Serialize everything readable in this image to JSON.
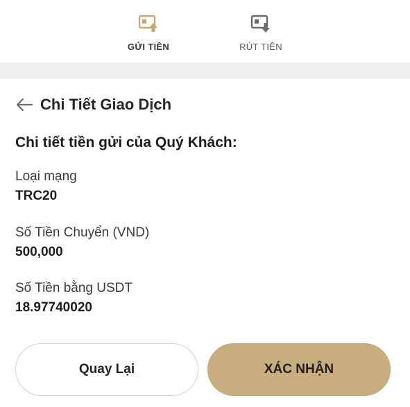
{
  "tabs": {
    "deposit": {
      "label": "GỬI TIỀN",
      "icon": "deposit-icon"
    },
    "withdraw": {
      "label": "RÚT TIỀN",
      "icon": "withdraw-icon"
    }
  },
  "header": {
    "title": "Chi Tiết Giao Dịch",
    "back_icon": "arrow-left-icon"
  },
  "details": {
    "section_title": "Chi tiết tiền gửi của Quý Khách:",
    "network_label": "Loại mạng",
    "network_value": "TRC20",
    "amount_label": "Số Tiền Chuyển (VND)",
    "amount_value": "500,000",
    "usdt_label": "Số Tiền bằng USDT",
    "usdt_value": "18.97740020"
  },
  "actions": {
    "back_label": "Quay Lại",
    "confirm_label": "XÁC NHẬN"
  },
  "colors": {
    "accent_gold": "#c8ad7f",
    "active_icon": "#c8a96b",
    "inactive_icon": "#6b6b6b"
  }
}
